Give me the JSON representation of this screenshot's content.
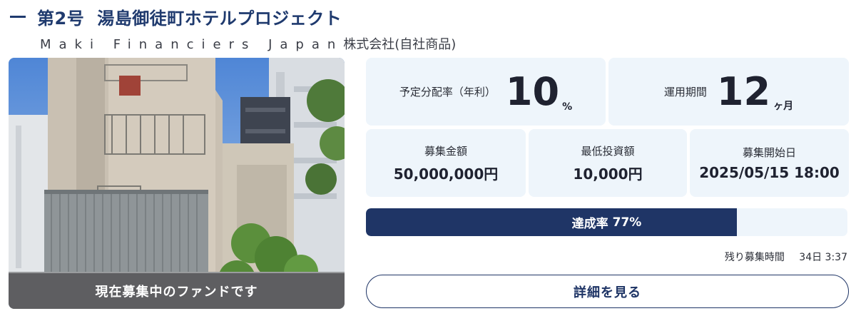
{
  "fund": {
    "number": "第2号",
    "name": "湯島御徒町ホテルプロジェクト",
    "operator_latin": "Maki Financiers Japan",
    "operator_suffix": "株式会社(自社商品)"
  },
  "photo": {
    "banner": "現在募集中のファンドです"
  },
  "stats": {
    "rate_label": "予定分配率（年利）",
    "rate_value": "10",
    "rate_unit": "%",
    "period_label": "運用期間",
    "period_value": "12",
    "period_unit": "ヶ月",
    "amount_label": "募集金額",
    "amount_value": "50,000,000円",
    "min_label": "最低投資額",
    "min_value": "10,000円",
    "start_label": "募集開始日",
    "start_value": "2025/05/15 18:00"
  },
  "progress": {
    "label": "達成率",
    "value": "77%",
    "fraction": 0.77
  },
  "remaining": {
    "label": "残り募集時間",
    "value": "34日 3:37"
  },
  "buttons": {
    "detail": "詳細を見る"
  },
  "colors": {
    "navy": "#1f3566",
    "card_bg": "#eef5fb"
  }
}
